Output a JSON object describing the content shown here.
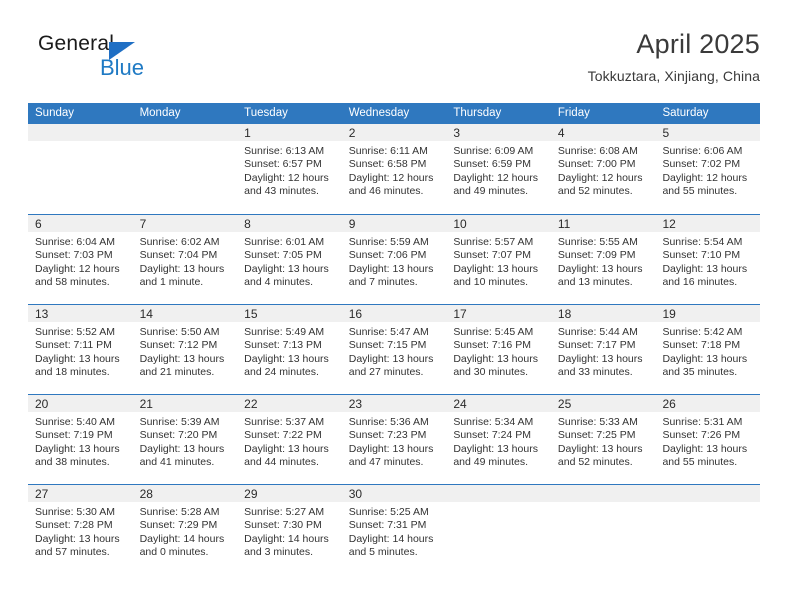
{
  "logo": {
    "word_one": "General",
    "word_two": "Blue",
    "triangle_icon": "triangle-icon",
    "brand_color": "#1f7ac4"
  },
  "header": {
    "month_title": "April 2025",
    "location": "Tokkuztara, Xinjiang, China"
  },
  "calendar": {
    "header_color": "#2f78bf",
    "weekdays": [
      "Sunday",
      "Monday",
      "Tuesday",
      "Wednesday",
      "Thursday",
      "Friday",
      "Saturday"
    ],
    "weeks": [
      [
        {
          "day": "",
          "sunrise": "",
          "sunset": "",
          "daylight_line1": "",
          "daylight_line2": ""
        },
        {
          "day": "",
          "sunrise": "",
          "sunset": "",
          "daylight_line1": "",
          "daylight_line2": ""
        },
        {
          "day": "1",
          "sunrise": "Sunrise: 6:13 AM",
          "sunset": "Sunset: 6:57 PM",
          "daylight_line1": "Daylight: 12 hours",
          "daylight_line2": "and 43 minutes."
        },
        {
          "day": "2",
          "sunrise": "Sunrise: 6:11 AM",
          "sunset": "Sunset: 6:58 PM",
          "daylight_line1": "Daylight: 12 hours",
          "daylight_line2": "and 46 minutes."
        },
        {
          "day": "3",
          "sunrise": "Sunrise: 6:09 AM",
          "sunset": "Sunset: 6:59 PM",
          "daylight_line1": "Daylight: 12 hours",
          "daylight_line2": "and 49 minutes."
        },
        {
          "day": "4",
          "sunrise": "Sunrise: 6:08 AM",
          "sunset": "Sunset: 7:00 PM",
          "daylight_line1": "Daylight: 12 hours",
          "daylight_line2": "and 52 minutes."
        },
        {
          "day": "5",
          "sunrise": "Sunrise: 6:06 AM",
          "sunset": "Sunset: 7:02 PM",
          "daylight_line1": "Daylight: 12 hours",
          "daylight_line2": "and 55 minutes."
        }
      ],
      [
        {
          "day": "6",
          "sunrise": "Sunrise: 6:04 AM",
          "sunset": "Sunset: 7:03 PM",
          "daylight_line1": "Daylight: 12 hours",
          "daylight_line2": "and 58 minutes."
        },
        {
          "day": "7",
          "sunrise": "Sunrise: 6:02 AM",
          "sunset": "Sunset: 7:04 PM",
          "daylight_line1": "Daylight: 13 hours",
          "daylight_line2": "and 1 minute."
        },
        {
          "day": "8",
          "sunrise": "Sunrise: 6:01 AM",
          "sunset": "Sunset: 7:05 PM",
          "daylight_line1": "Daylight: 13 hours",
          "daylight_line2": "and 4 minutes."
        },
        {
          "day": "9",
          "sunrise": "Sunrise: 5:59 AM",
          "sunset": "Sunset: 7:06 PM",
          "daylight_line1": "Daylight: 13 hours",
          "daylight_line2": "and 7 minutes."
        },
        {
          "day": "10",
          "sunrise": "Sunrise: 5:57 AM",
          "sunset": "Sunset: 7:07 PM",
          "daylight_line1": "Daylight: 13 hours",
          "daylight_line2": "and 10 minutes."
        },
        {
          "day": "11",
          "sunrise": "Sunrise: 5:55 AM",
          "sunset": "Sunset: 7:09 PM",
          "daylight_line1": "Daylight: 13 hours",
          "daylight_line2": "and 13 minutes."
        },
        {
          "day": "12",
          "sunrise": "Sunrise: 5:54 AM",
          "sunset": "Sunset: 7:10 PM",
          "daylight_line1": "Daylight: 13 hours",
          "daylight_line2": "and 16 minutes."
        }
      ],
      [
        {
          "day": "13",
          "sunrise": "Sunrise: 5:52 AM",
          "sunset": "Sunset: 7:11 PM",
          "daylight_line1": "Daylight: 13 hours",
          "daylight_line2": "and 18 minutes."
        },
        {
          "day": "14",
          "sunrise": "Sunrise: 5:50 AM",
          "sunset": "Sunset: 7:12 PM",
          "daylight_line1": "Daylight: 13 hours",
          "daylight_line2": "and 21 minutes."
        },
        {
          "day": "15",
          "sunrise": "Sunrise: 5:49 AM",
          "sunset": "Sunset: 7:13 PM",
          "daylight_line1": "Daylight: 13 hours",
          "daylight_line2": "and 24 minutes."
        },
        {
          "day": "16",
          "sunrise": "Sunrise: 5:47 AM",
          "sunset": "Sunset: 7:15 PM",
          "daylight_line1": "Daylight: 13 hours",
          "daylight_line2": "and 27 minutes."
        },
        {
          "day": "17",
          "sunrise": "Sunrise: 5:45 AM",
          "sunset": "Sunset: 7:16 PM",
          "daylight_line1": "Daylight: 13 hours",
          "daylight_line2": "and 30 minutes."
        },
        {
          "day": "18",
          "sunrise": "Sunrise: 5:44 AM",
          "sunset": "Sunset: 7:17 PM",
          "daylight_line1": "Daylight: 13 hours",
          "daylight_line2": "and 33 minutes."
        },
        {
          "day": "19",
          "sunrise": "Sunrise: 5:42 AM",
          "sunset": "Sunset: 7:18 PM",
          "daylight_line1": "Daylight: 13 hours",
          "daylight_line2": "and 35 minutes."
        }
      ],
      [
        {
          "day": "20",
          "sunrise": "Sunrise: 5:40 AM",
          "sunset": "Sunset: 7:19 PM",
          "daylight_line1": "Daylight: 13 hours",
          "daylight_line2": "and 38 minutes."
        },
        {
          "day": "21",
          "sunrise": "Sunrise: 5:39 AM",
          "sunset": "Sunset: 7:20 PM",
          "daylight_line1": "Daylight: 13 hours",
          "daylight_line2": "and 41 minutes."
        },
        {
          "day": "22",
          "sunrise": "Sunrise: 5:37 AM",
          "sunset": "Sunset: 7:22 PM",
          "daylight_line1": "Daylight: 13 hours",
          "daylight_line2": "and 44 minutes."
        },
        {
          "day": "23",
          "sunrise": "Sunrise: 5:36 AM",
          "sunset": "Sunset: 7:23 PM",
          "daylight_line1": "Daylight: 13 hours",
          "daylight_line2": "and 47 minutes."
        },
        {
          "day": "24",
          "sunrise": "Sunrise: 5:34 AM",
          "sunset": "Sunset: 7:24 PM",
          "daylight_line1": "Daylight: 13 hours",
          "daylight_line2": "and 49 minutes."
        },
        {
          "day": "25",
          "sunrise": "Sunrise: 5:33 AM",
          "sunset": "Sunset: 7:25 PM",
          "daylight_line1": "Daylight: 13 hours",
          "daylight_line2": "and 52 minutes."
        },
        {
          "day": "26",
          "sunrise": "Sunrise: 5:31 AM",
          "sunset": "Sunset: 7:26 PM",
          "daylight_line1": "Daylight: 13 hours",
          "daylight_line2": "and 55 minutes."
        }
      ],
      [
        {
          "day": "27",
          "sunrise": "Sunrise: 5:30 AM",
          "sunset": "Sunset: 7:28 PM",
          "daylight_line1": "Daylight: 13 hours",
          "daylight_line2": "and 57 minutes."
        },
        {
          "day": "28",
          "sunrise": "Sunrise: 5:28 AM",
          "sunset": "Sunset: 7:29 PM",
          "daylight_line1": "Daylight: 14 hours",
          "daylight_line2": "and 0 minutes."
        },
        {
          "day": "29",
          "sunrise": "Sunrise: 5:27 AM",
          "sunset": "Sunset: 7:30 PM",
          "daylight_line1": "Daylight: 14 hours",
          "daylight_line2": "and 3 minutes."
        },
        {
          "day": "30",
          "sunrise": "Sunrise: 5:25 AM",
          "sunset": "Sunset: 7:31 PM",
          "daylight_line1": "Daylight: 14 hours",
          "daylight_line2": "and 5 minutes."
        },
        {
          "day": "",
          "sunrise": "",
          "sunset": "",
          "daylight_line1": "",
          "daylight_line2": ""
        },
        {
          "day": "",
          "sunrise": "",
          "sunset": "",
          "daylight_line1": "",
          "daylight_line2": ""
        },
        {
          "day": "",
          "sunrise": "",
          "sunset": "",
          "daylight_line1": "",
          "daylight_line2": ""
        }
      ]
    ]
  }
}
